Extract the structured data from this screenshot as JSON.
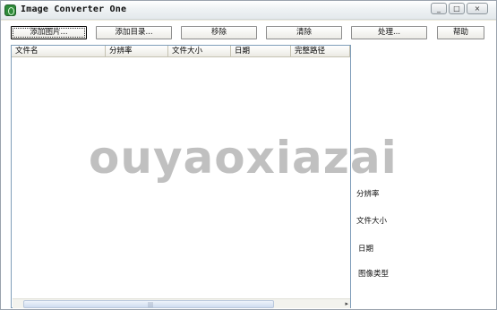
{
  "window": {
    "title": "Image Converter One"
  },
  "title_buttons": {
    "minimize": "_",
    "maximize": "□",
    "close": "×"
  },
  "toolbar": {
    "add_image": "添加图片...",
    "add_dir": "添加目录...",
    "remove": "移除",
    "clear": "清除",
    "process": "处理...",
    "help": "帮助"
  },
  "list": {
    "columns": [
      "文件名",
      "分辨率",
      "文件大小",
      "日期",
      "完整路径"
    ]
  },
  "info_panel": {
    "resolution": "分辨率",
    "file_size": "文件大小",
    "date": "日期",
    "image_type": "图像类型"
  },
  "watermark": "ouyaoxiazai",
  "scrollbar": {
    "grip": "|||",
    "right_arrow": "▸"
  }
}
